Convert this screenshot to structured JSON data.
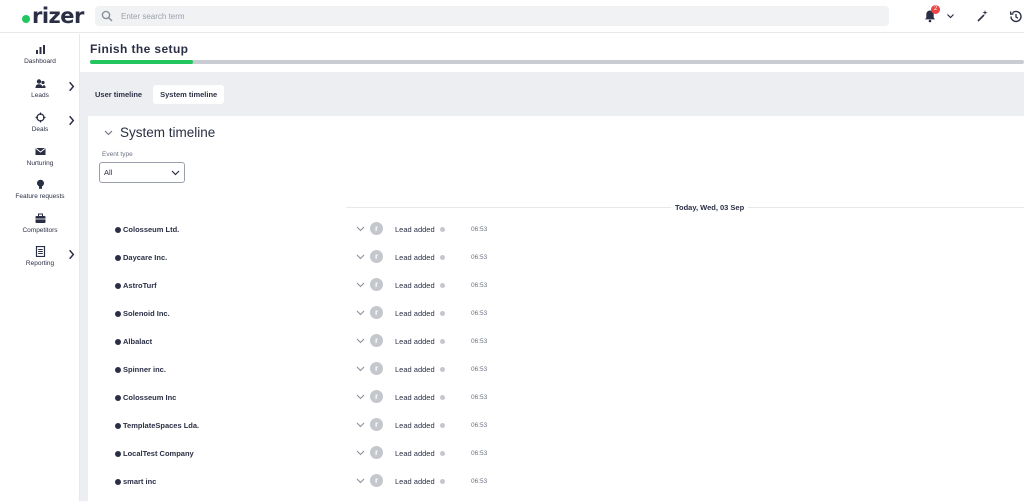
{
  "app": {
    "logo": "rizer"
  },
  "search": {
    "placeholder": "Enter search term"
  },
  "header": {
    "notification_count": "2"
  },
  "sidebar": {
    "items": [
      {
        "label": "Dashboard",
        "icon": "bar-chart-icon"
      },
      {
        "label": "Leads",
        "icon": "users-icon"
      },
      {
        "label": "Deals",
        "icon": "crosshair-icon"
      },
      {
        "label": "Nurturing",
        "icon": "envelope-icon"
      },
      {
        "label": "Feature requests",
        "icon": "lightbulb-icon"
      },
      {
        "label": "Competitors",
        "icon": "briefcase-icon"
      },
      {
        "label": "Reporting",
        "icon": "report-icon"
      }
    ]
  },
  "setup": {
    "title": "Finish the setup",
    "progress": 0.11
  },
  "tabs": [
    {
      "label": "User timeline"
    },
    {
      "label": "System timeline"
    }
  ],
  "timeline": {
    "title": "System timeline",
    "filter": {
      "label": "Event type",
      "value": "All"
    },
    "date_label": "Today, Wed, 03 Sep",
    "rows": [
      {
        "name": "Colosseum Ltd.",
        "avatar": "r",
        "event": "Lead added",
        "time": "06:53"
      },
      {
        "name": "Daycare Inc.",
        "avatar": "r",
        "event": "Lead added",
        "time": "06:53"
      },
      {
        "name": "AstroTurf",
        "avatar": "r",
        "event": "Lead added",
        "time": "06:53"
      },
      {
        "name": "Solenoid Inc.",
        "avatar": "r",
        "event": "Lead added",
        "time": "06:53"
      },
      {
        "name": "Albalact",
        "avatar": "r",
        "event": "Lead added",
        "time": "06:53"
      },
      {
        "name": "Spinner inc.",
        "avatar": "r",
        "event": "Lead added",
        "time": "06:53"
      },
      {
        "name": "Colosseum Inc",
        "avatar": "r",
        "event": "Lead added",
        "time": "06:53"
      },
      {
        "name": "TemplateSpaces Lda.",
        "avatar": "r",
        "event": "Lead added",
        "time": "06:53"
      },
      {
        "name": "LocalTest Company",
        "avatar": "r",
        "event": "Lead added",
        "time": "06:53"
      },
      {
        "name": "smart inc",
        "avatar": "r",
        "event": "Lead added",
        "time": "06:53"
      }
    ]
  }
}
